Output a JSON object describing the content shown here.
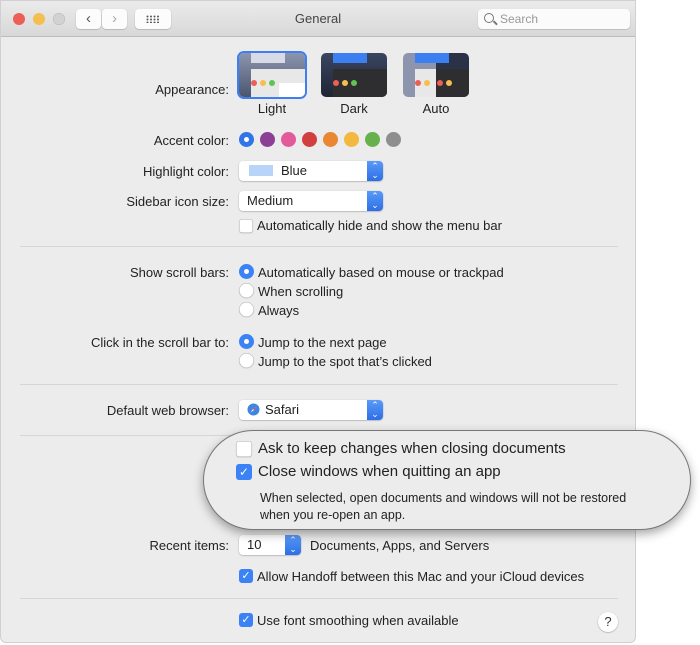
{
  "window": {
    "title": "General",
    "search_placeholder": "Search"
  },
  "appearance": {
    "label": "Appearance:",
    "options": [
      {
        "name": "Light",
        "selected": true
      },
      {
        "name": "Dark",
        "selected": false
      },
      {
        "name": "Auto",
        "selected": false
      }
    ]
  },
  "accent": {
    "label": "Accent color:",
    "colors": [
      "#2f74e8",
      "#8b3f95",
      "#e35a9b",
      "#d23f3f",
      "#ea8733",
      "#f3b93e",
      "#67b04c",
      "#8e8e8e"
    ],
    "selected_index": 0
  },
  "highlight": {
    "label": "Highlight color:",
    "value": "Blue",
    "swatch_color": "#b8d4f9"
  },
  "sidebar_size": {
    "label": "Sidebar icon size:",
    "value": "Medium"
  },
  "menu_bar": {
    "label": "Automatically hide and show the menu bar",
    "checked": false
  },
  "scroll_bars": {
    "label": "Show scroll bars:",
    "options": [
      {
        "label": "Automatically based on mouse or trackpad",
        "selected": true
      },
      {
        "label": "When scrolling",
        "selected": false
      },
      {
        "label": "Always",
        "selected": false
      }
    ]
  },
  "scroll_click": {
    "label": "Click in the scroll bar to:",
    "options": [
      {
        "label": "Jump to the next page",
        "selected": true
      },
      {
        "label": "Jump to the spot that’s clicked",
        "selected": false
      }
    ]
  },
  "browser": {
    "label": "Default web browser:",
    "value": "Safari"
  },
  "callout": {
    "ask_keep": {
      "label": "Ask to keep changes when closing documents",
      "checked": false
    },
    "close_windows": {
      "label": "Close windows when quitting an app",
      "checked": true
    },
    "description": [
      "When selected, open documents and windows will not be restored",
      "when you re-open an app."
    ]
  },
  "recent": {
    "label": "Recent items:",
    "value": "10",
    "suffix": "Documents, Apps, and Servers"
  },
  "handoff": {
    "label": "Allow Handoff between this Mac and your iCloud devices",
    "checked": true
  },
  "font_smoothing": {
    "label": "Use font smoothing when available",
    "checked": true
  },
  "help": {
    "glyph": "?"
  },
  "icons": {
    "back": "‹",
    "forward": "›",
    "check": "✓",
    "stepper": "⌃⌄"
  }
}
